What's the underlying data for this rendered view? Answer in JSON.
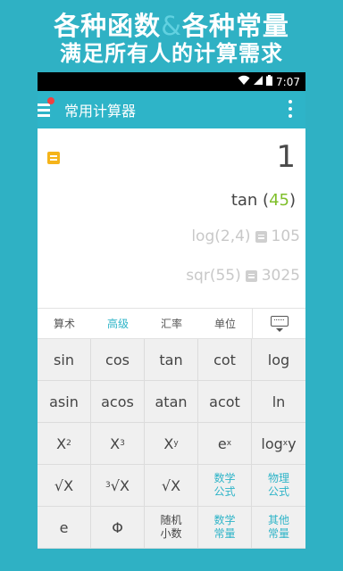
{
  "promo": {
    "line1_a": "各种函数",
    "amp": "&",
    "line1_b": "各种常量",
    "line2": "满足所有人的计算需求"
  },
  "statusbar": {
    "time": "7:07"
  },
  "appbar": {
    "title": "常用计算器"
  },
  "display": {
    "result": "1",
    "expression_fn": "tan ",
    "expression_open": "(",
    "expression_arg": "45",
    "expression_close": ")",
    "history": [
      {
        "expr": "log(2,4)",
        "value": "105"
      },
      {
        "expr": "sqr(55)",
        "value": "3025"
      }
    ]
  },
  "tabs": [
    "算术",
    "高级",
    "汇率",
    "单位"
  ],
  "keys": {
    "r1": [
      "sin",
      "cos",
      "tan",
      "cot",
      "log"
    ],
    "r2": [
      "asin",
      "acos",
      "atan",
      "acot",
      "ln"
    ],
    "r3": {
      "x2_base": "X",
      "x2_exp": "2",
      "x3_base": "X",
      "x3_exp": "3",
      "xy_base": "X",
      "xy_exp": "y",
      "ex_base": "e",
      "ex_exp": "x",
      "logxy_a": "log",
      "logxy_sub": "x",
      "logxy_b": "y"
    },
    "r4": {
      "sqrt": "√X",
      "cbrt_idx": "3",
      "cbrt": "√X",
      "yroot": "√X",
      "math_formula_1": "数学",
      "math_formula_2": "公式",
      "phys_formula_1": "物理",
      "phys_formula_2": "公式"
    },
    "r5": {
      "e": "e",
      "phi": "Φ",
      "random_1": "随机",
      "random_2": "小数",
      "math_const_1": "数学",
      "math_const_2": "常量",
      "other_const_1": "其他",
      "other_const_2": "常量"
    }
  },
  "colors": {
    "accent": "#2eb4c8",
    "background": "#2fb1c4",
    "highlight": "#7fbf2a",
    "note": "#f5b41a"
  }
}
